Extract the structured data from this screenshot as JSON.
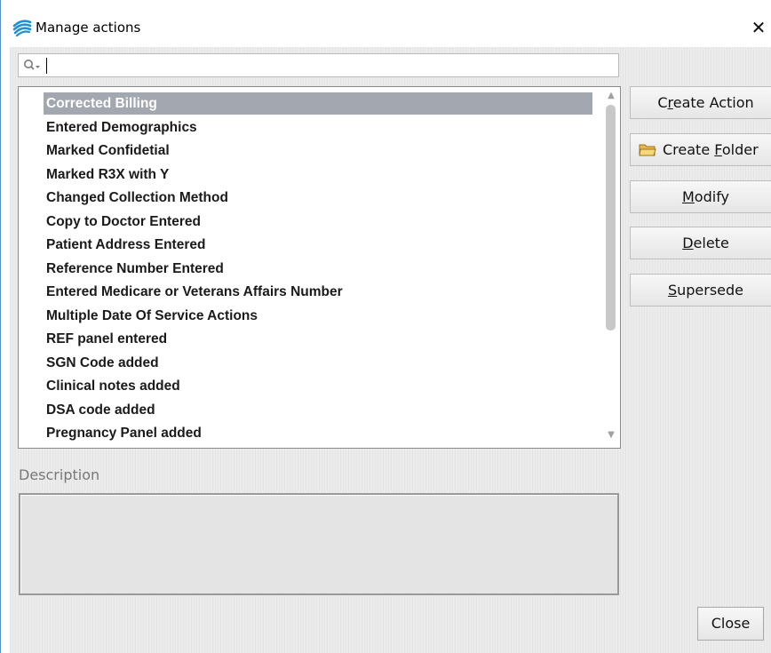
{
  "window": {
    "title": "Manage actions",
    "close_glyph": "✕"
  },
  "search": {
    "value": "",
    "placeholder": ""
  },
  "actions_list": {
    "selected_index": 0,
    "items": [
      "Corrected Billing",
      "Entered Demographics",
      "Marked Confidetial",
      "Marked R3X with Y",
      "Changed Collection Method",
      "Copy to Doctor Entered",
      "Patient Address Entered",
      "Reference Number Entered",
      "Entered Medicare or Veterans Affairs Number",
      "Multiple Date Of Service Actions",
      "REF panel entered",
      "SGN Code added",
      "Clinical notes added",
      "DSA code added",
      "Pregnancy Panel added"
    ]
  },
  "buttons": {
    "create_action": {
      "pre": "C",
      "ul": "r",
      "post": "eate Action"
    },
    "create_folder": {
      "pre": "Create ",
      "ul": "F",
      "post": "older",
      "icon": "folder-icon"
    },
    "modify": {
      "pre": "",
      "ul": "M",
      "post": "odify"
    },
    "delete": {
      "pre": "",
      "ul": "D",
      "post": "elete"
    },
    "supersede": {
      "pre": "",
      "ul": "S",
      "post": "upersede"
    },
    "close": {
      "pre": "",
      "ul": "C",
      "post": "lose"
    }
  },
  "description": {
    "label": "Description",
    "value": ""
  },
  "colors": {
    "selection": "#a3a7b0",
    "window_border": "#5b8fc7",
    "app_icon": "#1f8fd6"
  }
}
